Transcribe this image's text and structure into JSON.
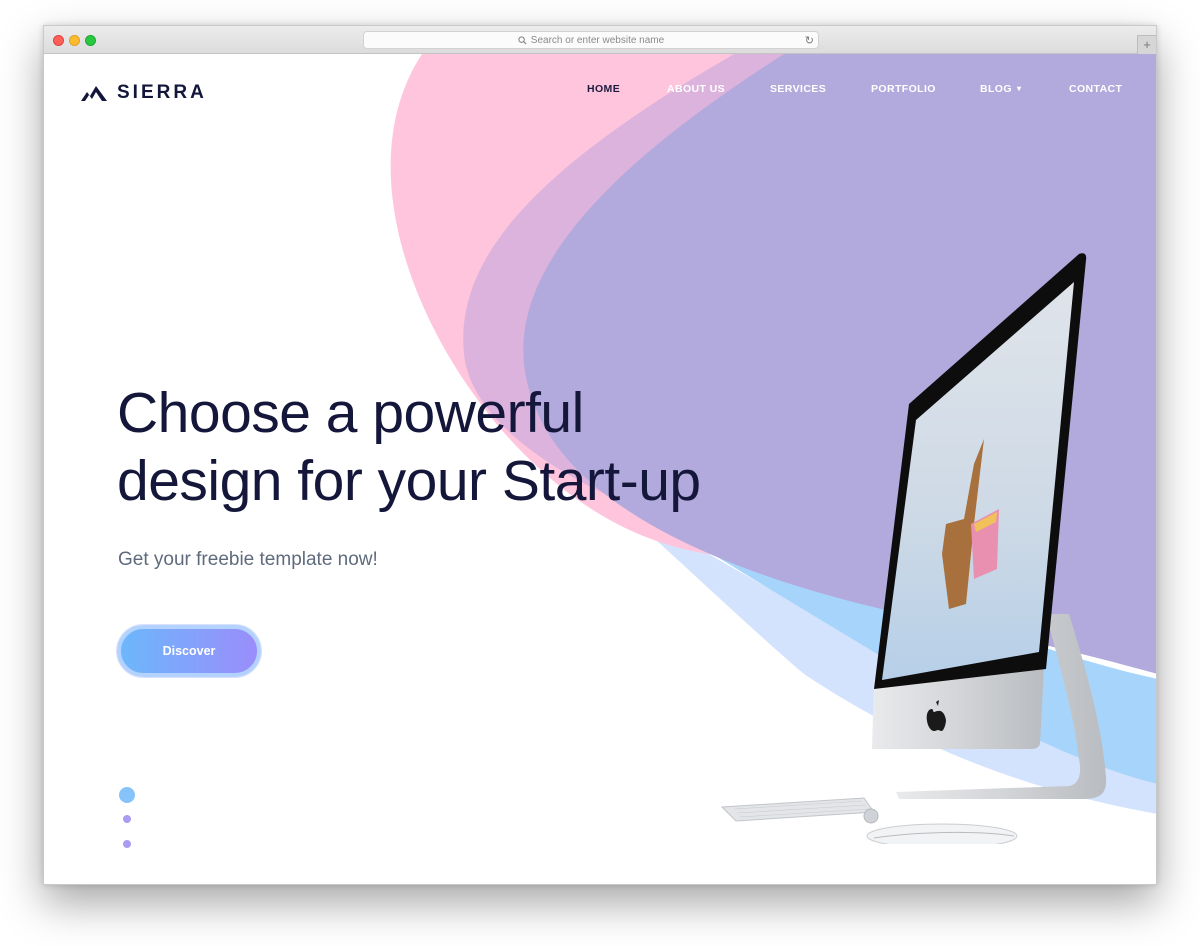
{
  "browser": {
    "url_placeholder": "Search or enter website name",
    "new_tab_label": "+",
    "reload_icon": "↻"
  },
  "site": {
    "logo_text": "SIERRA",
    "logo_icon": "mountain-icon"
  },
  "nav": {
    "items": [
      {
        "label": "HOME",
        "active": true
      },
      {
        "label": "ABOUT US",
        "active": false
      },
      {
        "label": "SERVICES",
        "active": false
      },
      {
        "label": "PORTFOLIO",
        "active": false
      },
      {
        "label": "BLOG",
        "active": false,
        "has_dropdown": true
      },
      {
        "label": "CONTACT",
        "active": false
      }
    ],
    "dropdown_caret": "▾"
  },
  "hero": {
    "title_line1": "Choose a powerful",
    "title_line2": "design for your Start-up",
    "subtitle": "Get your freebie template now!",
    "cta_label": "Discover"
  },
  "slider": {
    "total": 3,
    "active_index": 0
  },
  "colors": {
    "pink": "#fec5dc",
    "mauve": "#dcb3dc",
    "lavender": "#b2a9dc",
    "sky": "#a7d4fa",
    "pale_blue": "#d3e3fd",
    "title": "#14163a",
    "subtitle": "#5f6b7d",
    "cta_start": "#6cb7fb",
    "cta_end": "#9a8dfb"
  }
}
